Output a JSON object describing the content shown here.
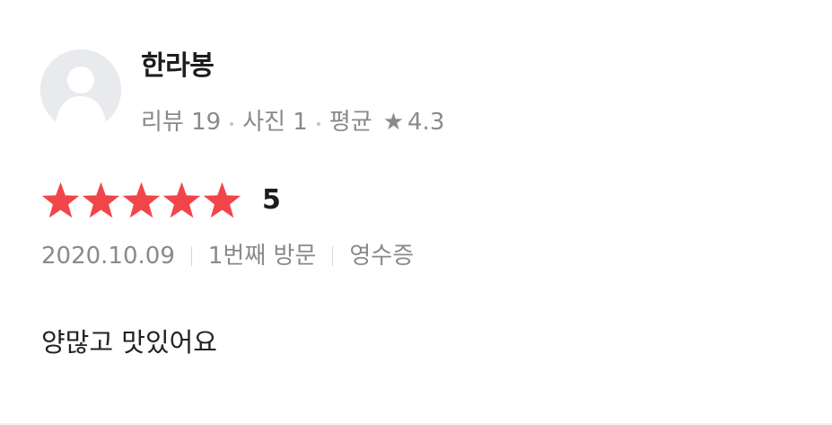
{
  "user": {
    "name": "한라봉",
    "avatar_icon": "default-profile-icon",
    "review_count_label": "리뷰 19",
    "photo_count_label": "사진 1",
    "average_label": "평균",
    "average_star": "★",
    "average_value": "4.3"
  },
  "rating": {
    "stars": 5,
    "max_stars": 5,
    "value": "5",
    "star_icon": "star-icon",
    "star_color": "#f2454a"
  },
  "meta": {
    "date": "2020.10.09",
    "visit": "1번째 방문",
    "verification": "영수증"
  },
  "review": {
    "text": "양많고 맛있어요"
  }
}
